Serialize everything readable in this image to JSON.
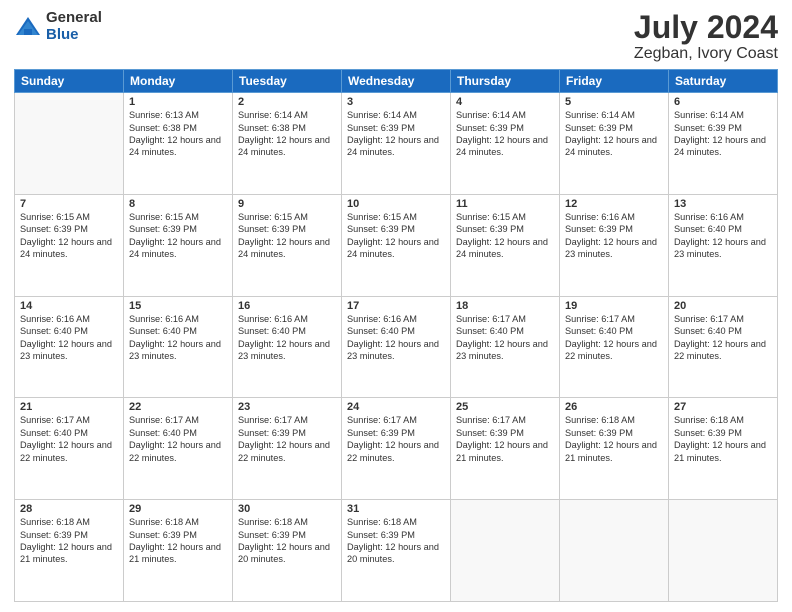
{
  "logo": {
    "general": "General",
    "blue": "Blue"
  },
  "title": "July 2024",
  "subtitle": "Zegban, Ivory Coast",
  "days_of_week": [
    "Sunday",
    "Monday",
    "Tuesday",
    "Wednesday",
    "Thursday",
    "Friday",
    "Saturday"
  ],
  "weeks": [
    [
      {
        "day": "",
        "empty": true
      },
      {
        "day": "1",
        "sunrise": "6:13 AM",
        "sunset": "6:38 PM",
        "daylight": "12 hours and 24 minutes."
      },
      {
        "day": "2",
        "sunrise": "6:14 AM",
        "sunset": "6:38 PM",
        "daylight": "12 hours and 24 minutes."
      },
      {
        "day": "3",
        "sunrise": "6:14 AM",
        "sunset": "6:39 PM",
        "daylight": "12 hours and 24 minutes."
      },
      {
        "day": "4",
        "sunrise": "6:14 AM",
        "sunset": "6:39 PM",
        "daylight": "12 hours and 24 minutes."
      },
      {
        "day": "5",
        "sunrise": "6:14 AM",
        "sunset": "6:39 PM",
        "daylight": "12 hours and 24 minutes."
      },
      {
        "day": "6",
        "sunrise": "6:14 AM",
        "sunset": "6:39 PM",
        "daylight": "12 hours and 24 minutes."
      }
    ],
    [
      {
        "day": "7",
        "sunrise": "6:15 AM",
        "sunset": "6:39 PM",
        "daylight": "12 hours and 24 minutes."
      },
      {
        "day": "8",
        "sunrise": "6:15 AM",
        "sunset": "6:39 PM",
        "daylight": "12 hours and 24 minutes."
      },
      {
        "day": "9",
        "sunrise": "6:15 AM",
        "sunset": "6:39 PM",
        "daylight": "12 hours and 24 minutes."
      },
      {
        "day": "10",
        "sunrise": "6:15 AM",
        "sunset": "6:39 PM",
        "daylight": "12 hours and 24 minutes."
      },
      {
        "day": "11",
        "sunrise": "6:15 AM",
        "sunset": "6:39 PM",
        "daylight": "12 hours and 24 minutes."
      },
      {
        "day": "12",
        "sunrise": "6:16 AM",
        "sunset": "6:39 PM",
        "daylight": "12 hours and 23 minutes."
      },
      {
        "day": "13",
        "sunrise": "6:16 AM",
        "sunset": "6:40 PM",
        "daylight": "12 hours and 23 minutes."
      }
    ],
    [
      {
        "day": "14",
        "sunrise": "6:16 AM",
        "sunset": "6:40 PM",
        "daylight": "12 hours and 23 minutes."
      },
      {
        "day": "15",
        "sunrise": "6:16 AM",
        "sunset": "6:40 PM",
        "daylight": "12 hours and 23 minutes."
      },
      {
        "day": "16",
        "sunrise": "6:16 AM",
        "sunset": "6:40 PM",
        "daylight": "12 hours and 23 minutes."
      },
      {
        "day": "17",
        "sunrise": "6:16 AM",
        "sunset": "6:40 PM",
        "daylight": "12 hours and 23 minutes."
      },
      {
        "day": "18",
        "sunrise": "6:17 AM",
        "sunset": "6:40 PM",
        "daylight": "12 hours and 23 minutes."
      },
      {
        "day": "19",
        "sunrise": "6:17 AM",
        "sunset": "6:40 PM",
        "daylight": "12 hours and 22 minutes."
      },
      {
        "day": "20",
        "sunrise": "6:17 AM",
        "sunset": "6:40 PM",
        "daylight": "12 hours and 22 minutes."
      }
    ],
    [
      {
        "day": "21",
        "sunrise": "6:17 AM",
        "sunset": "6:40 PM",
        "daylight": "12 hours and 22 minutes."
      },
      {
        "day": "22",
        "sunrise": "6:17 AM",
        "sunset": "6:40 PM",
        "daylight": "12 hours and 22 minutes."
      },
      {
        "day": "23",
        "sunrise": "6:17 AM",
        "sunset": "6:39 PM",
        "daylight": "12 hours and 22 minutes."
      },
      {
        "day": "24",
        "sunrise": "6:17 AM",
        "sunset": "6:39 PM",
        "daylight": "12 hours and 22 minutes."
      },
      {
        "day": "25",
        "sunrise": "6:17 AM",
        "sunset": "6:39 PM",
        "daylight": "12 hours and 21 minutes."
      },
      {
        "day": "26",
        "sunrise": "6:18 AM",
        "sunset": "6:39 PM",
        "daylight": "12 hours and 21 minutes."
      },
      {
        "day": "27",
        "sunrise": "6:18 AM",
        "sunset": "6:39 PM",
        "daylight": "12 hours and 21 minutes."
      }
    ],
    [
      {
        "day": "28",
        "sunrise": "6:18 AM",
        "sunset": "6:39 PM",
        "daylight": "12 hours and 21 minutes."
      },
      {
        "day": "29",
        "sunrise": "6:18 AM",
        "sunset": "6:39 PM",
        "daylight": "12 hours and 21 minutes."
      },
      {
        "day": "30",
        "sunrise": "6:18 AM",
        "sunset": "6:39 PM",
        "daylight": "12 hours and 20 minutes."
      },
      {
        "day": "31",
        "sunrise": "6:18 AM",
        "sunset": "6:39 PM",
        "daylight": "12 hours and 20 minutes."
      },
      {
        "day": "",
        "empty": true
      },
      {
        "day": "",
        "empty": true
      },
      {
        "day": "",
        "empty": true
      }
    ]
  ]
}
